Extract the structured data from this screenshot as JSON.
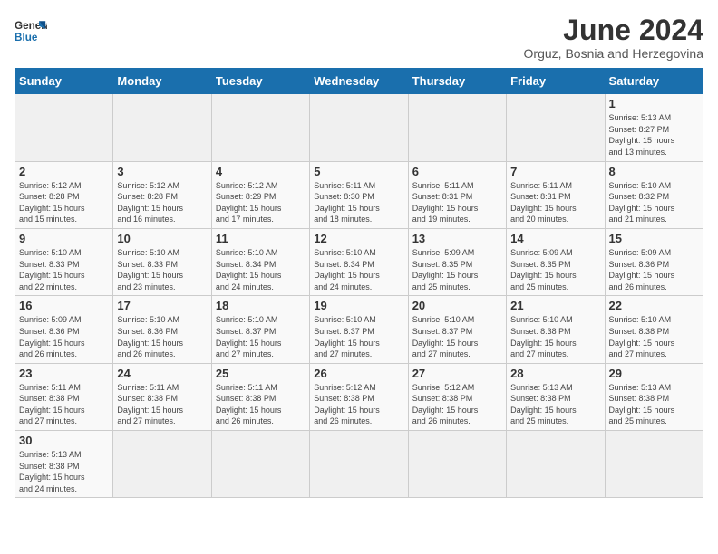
{
  "header": {
    "logo_general": "General",
    "logo_blue": "Blue",
    "month_title": "June 2024",
    "subtitle": "Orguz, Bosnia and Herzegovina"
  },
  "days_of_week": [
    "Sunday",
    "Monday",
    "Tuesday",
    "Wednesday",
    "Thursday",
    "Friday",
    "Saturday"
  ],
  "weeks": [
    [
      {
        "day": "",
        "info": ""
      },
      {
        "day": "",
        "info": ""
      },
      {
        "day": "",
        "info": ""
      },
      {
        "day": "",
        "info": ""
      },
      {
        "day": "",
        "info": ""
      },
      {
        "day": "",
        "info": ""
      },
      {
        "day": "1",
        "info": "Sunrise: 5:13 AM\nSunset: 8:27 PM\nDaylight: 15 hours\nand 13 minutes."
      }
    ],
    [
      {
        "day": "2",
        "info": "Sunrise: 5:12 AM\nSunset: 8:28 PM\nDaylight: 15 hours\nand 15 minutes."
      },
      {
        "day": "3",
        "info": "Sunrise: 5:12 AM\nSunset: 8:28 PM\nDaylight: 15 hours\nand 16 minutes."
      },
      {
        "day": "4",
        "info": "Sunrise: 5:12 AM\nSunset: 8:29 PM\nDaylight: 15 hours\nand 17 minutes."
      },
      {
        "day": "5",
        "info": "Sunrise: 5:11 AM\nSunset: 8:30 PM\nDaylight: 15 hours\nand 18 minutes."
      },
      {
        "day": "6",
        "info": "Sunrise: 5:11 AM\nSunset: 8:31 PM\nDaylight: 15 hours\nand 19 minutes."
      },
      {
        "day": "7",
        "info": "Sunrise: 5:11 AM\nSunset: 8:31 PM\nDaylight: 15 hours\nand 20 minutes."
      },
      {
        "day": "8",
        "info": "Sunrise: 5:10 AM\nSunset: 8:32 PM\nDaylight: 15 hours\nand 21 minutes."
      }
    ],
    [
      {
        "day": "9",
        "info": "Sunrise: 5:10 AM\nSunset: 8:33 PM\nDaylight: 15 hours\nand 22 minutes."
      },
      {
        "day": "10",
        "info": "Sunrise: 5:10 AM\nSunset: 8:33 PM\nDaylight: 15 hours\nand 23 minutes."
      },
      {
        "day": "11",
        "info": "Sunrise: 5:10 AM\nSunset: 8:34 PM\nDaylight: 15 hours\nand 24 minutes."
      },
      {
        "day": "12",
        "info": "Sunrise: 5:10 AM\nSunset: 8:34 PM\nDaylight: 15 hours\nand 24 minutes."
      },
      {
        "day": "13",
        "info": "Sunrise: 5:09 AM\nSunset: 8:35 PM\nDaylight: 15 hours\nand 25 minutes."
      },
      {
        "day": "14",
        "info": "Sunrise: 5:09 AM\nSunset: 8:35 PM\nDaylight: 15 hours\nand 25 minutes."
      },
      {
        "day": "15",
        "info": "Sunrise: 5:09 AM\nSunset: 8:36 PM\nDaylight: 15 hours\nand 26 minutes."
      }
    ],
    [
      {
        "day": "16",
        "info": "Sunrise: 5:09 AM\nSunset: 8:36 PM\nDaylight: 15 hours\nand 26 minutes."
      },
      {
        "day": "17",
        "info": "Sunrise: 5:10 AM\nSunset: 8:36 PM\nDaylight: 15 hours\nand 26 minutes."
      },
      {
        "day": "18",
        "info": "Sunrise: 5:10 AM\nSunset: 8:37 PM\nDaylight: 15 hours\nand 27 minutes."
      },
      {
        "day": "19",
        "info": "Sunrise: 5:10 AM\nSunset: 8:37 PM\nDaylight: 15 hours\nand 27 minutes."
      },
      {
        "day": "20",
        "info": "Sunrise: 5:10 AM\nSunset: 8:37 PM\nDaylight: 15 hours\nand 27 minutes."
      },
      {
        "day": "21",
        "info": "Sunrise: 5:10 AM\nSunset: 8:38 PM\nDaylight: 15 hours\nand 27 minutes."
      },
      {
        "day": "22",
        "info": "Sunrise: 5:10 AM\nSunset: 8:38 PM\nDaylight: 15 hours\nand 27 minutes."
      }
    ],
    [
      {
        "day": "23",
        "info": "Sunrise: 5:11 AM\nSunset: 8:38 PM\nDaylight: 15 hours\nand 27 minutes."
      },
      {
        "day": "24",
        "info": "Sunrise: 5:11 AM\nSunset: 8:38 PM\nDaylight: 15 hours\nand 27 minutes."
      },
      {
        "day": "25",
        "info": "Sunrise: 5:11 AM\nSunset: 8:38 PM\nDaylight: 15 hours\nand 26 minutes."
      },
      {
        "day": "26",
        "info": "Sunrise: 5:12 AM\nSunset: 8:38 PM\nDaylight: 15 hours\nand 26 minutes."
      },
      {
        "day": "27",
        "info": "Sunrise: 5:12 AM\nSunset: 8:38 PM\nDaylight: 15 hours\nand 26 minutes."
      },
      {
        "day": "28",
        "info": "Sunrise: 5:13 AM\nSunset: 8:38 PM\nDaylight: 15 hours\nand 25 minutes."
      },
      {
        "day": "29",
        "info": "Sunrise: 5:13 AM\nSunset: 8:38 PM\nDaylight: 15 hours\nand 25 minutes."
      }
    ],
    [
      {
        "day": "30",
        "info": "Sunrise: 5:13 AM\nSunset: 8:38 PM\nDaylight: 15 hours\nand 24 minutes."
      },
      {
        "day": "",
        "info": ""
      },
      {
        "day": "",
        "info": ""
      },
      {
        "day": "",
        "info": ""
      },
      {
        "day": "",
        "info": ""
      },
      {
        "day": "",
        "info": ""
      },
      {
        "day": "",
        "info": ""
      }
    ]
  ]
}
